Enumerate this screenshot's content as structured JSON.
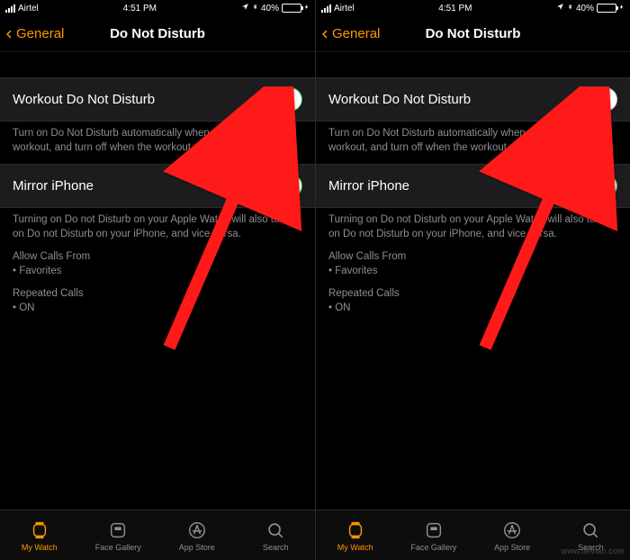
{
  "status": {
    "carrier": "Airtel",
    "time": "4:51 PM",
    "battery_pct": "40%"
  },
  "nav": {
    "back_label": "General",
    "title": "Do Not Disturb"
  },
  "rows": {
    "workout": {
      "label": "Workout Do Not Disturb",
      "footer": "Turn on Do Not Disturb automatically when you start a workout, and turn off when the workout ends."
    },
    "mirror": {
      "label": "Mirror iPhone",
      "footer": "Turning on Do not Disturb on your Apple Watch will also turn on Do not Disturb on your iPhone, and vice versa.",
      "allow_calls_title": "Allow Calls From",
      "allow_calls_value": "• Favorites",
      "repeated_title": "Repeated Calls",
      "repeated_value": "• ON"
    }
  },
  "left_phone": {
    "workout_on": true,
    "mirror_on": true
  },
  "right_phone": {
    "workout_on": false,
    "mirror_on": true
  },
  "tabs": {
    "my_watch": "My Watch",
    "face_gallery": "Face Gallery",
    "app_store": "App Store",
    "search": "Search"
  },
  "watermark": "www.devlan.com",
  "icons": {
    "location": "➤",
    "bluetooth": "✱"
  },
  "colors": {
    "accent": "#ff9500",
    "toggle_on": "#2fd158"
  }
}
